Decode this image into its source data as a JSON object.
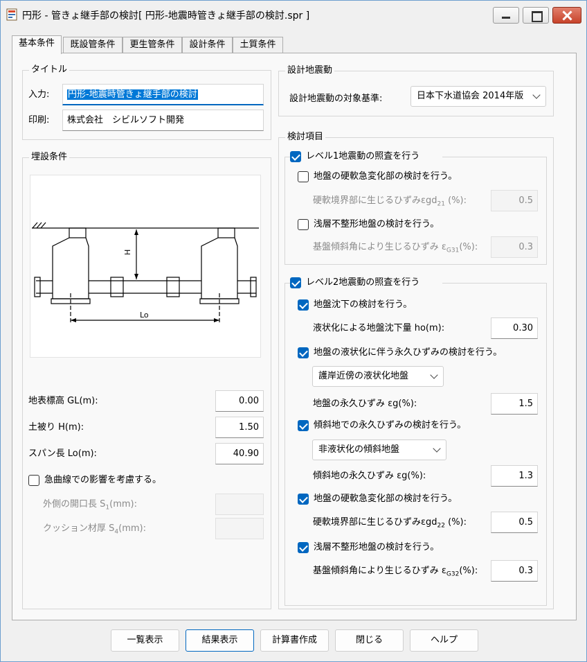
{
  "window": {
    "title": "円形 - 管きょ継手部の検討[ 円形-地震時管きょ継手部の検討.spr ]",
    "buttons": {
      "minimize": "minimize",
      "maximize": "maximize",
      "close": "close"
    }
  },
  "tabs": [
    {
      "label": "基本条件",
      "active": true
    },
    {
      "label": "既設管条件"
    },
    {
      "label": "更生管条件"
    },
    {
      "label": "設計条件"
    },
    {
      "label": "土質条件"
    }
  ],
  "title_group": {
    "title": "タイトル",
    "input_label": "入力:",
    "input_value": "円形-地震時管きょ継手部の検討",
    "print_label": "印刷:",
    "print_value": "株式会社　シビルソフト開発"
  },
  "burial_group": {
    "title": "埋設条件",
    "diagram": {
      "h_label": "H",
      "lo_label": "Lo"
    },
    "gl_label": "地表標高 GL(m):",
    "gl_value": "0.00",
    "h_label": "土被り H(m):",
    "h_value": "1.50",
    "span_label": "スパン長 Lo(m):",
    "span_value": "40.90",
    "curve_checkbox": "急曲線での影響を考慮する。",
    "curve_checked": false,
    "s1_label_pre": "外側の開口長 S",
    "s1_sub": "1",
    "s1_label_post": "(mm):",
    "s1_value": "",
    "s4_label_pre": "クッション材厚 S",
    "s4_sub": "4",
    "s4_label_post": "(mm):",
    "s4_value": ""
  },
  "design_quake": {
    "title": "設計地震動",
    "target_label": "設計地震動の対象基準:",
    "target_value": "日本下水道協会 2014年版"
  },
  "check_items": {
    "title": "検討項目",
    "level1": {
      "label": "レベル1地震動の照査を行う",
      "checked": true,
      "hard_soft": {
        "label": "地盤の硬軟急変化部の検討を行う。",
        "checked": false
      },
      "gd21_pre": "硬軟境界部に生じるひずみεgd",
      "gd21_sub": "21",
      "gd21_post": " (%):",
      "gd21_value": "0.5",
      "shallow": {
        "label": "浅層不整形地盤の検討を行う。",
        "checked": false
      },
      "g31_pre": "基盤傾斜角により生じるひずみ ε",
      "g31_sub": "G31",
      "g31_post": "(%):",
      "g31_value": "0.3"
    },
    "level2": {
      "label": "レベル2地震動の照査を行う",
      "checked": true,
      "subsidence": {
        "label": "地盤沈下の検討を行う。",
        "checked": true
      },
      "ho_label": "液状化による地盤沈下量 ho(m):",
      "ho_value": "0.30",
      "liquefaction": {
        "label": "地盤の液状化に伴う永久ひずみの検討を行う。",
        "checked": true
      },
      "liq_type": "護岸近傍の液状化地盤",
      "eg_label": "地盤の永久ひずみ εg(%):",
      "eg_value": "1.5",
      "slope": {
        "label": "傾斜地での永久ひずみの検討を行う。",
        "checked": true
      },
      "slope_type": "非液状化の傾斜地盤",
      "slope_eg_label": "傾斜地の永久ひずみ εg(%):",
      "slope_eg_value": "1.3",
      "hard_soft": {
        "label": "地盤の硬軟急変化部の検討を行う。",
        "checked": true
      },
      "gd22_pre": "硬軟境界部に生じるひずみεgd",
      "gd22_sub": "22",
      "gd22_post": " (%):",
      "gd22_value": "0.5",
      "shallow": {
        "label": "浅層不整形地盤の検討を行う。",
        "checked": true
      },
      "g32_pre": "基盤傾斜角により生じるひずみ ε",
      "g32_sub": "G32",
      "g32_post": "(%):",
      "g32_value": "0.3"
    }
  },
  "bottom_buttons": {
    "list": "一覧表示",
    "result": "結果表示",
    "report": "計算書作成",
    "close": "閉じる",
    "help": "ヘルプ"
  }
}
